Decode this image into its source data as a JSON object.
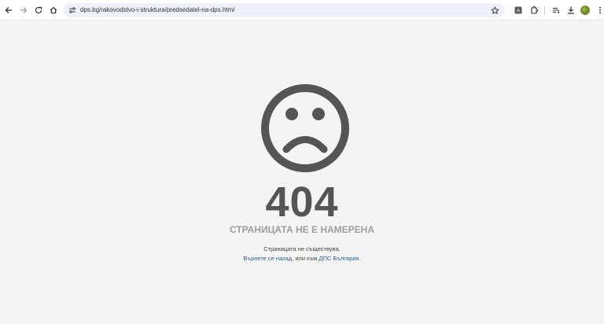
{
  "browser": {
    "url": "dps.bg/rakovodstvo-i-struktura/predsedatel-na-dps.html",
    "icons": [
      "back-arrow-icon",
      "forward-arrow-icon",
      "reload-icon",
      "home-icon",
      "site-info-icon",
      "bookmark-star-icon",
      "translate-icon",
      "extensions-icon",
      "reading-list-icon",
      "download-icon",
      "profile-avatar",
      "kebab-menu-icon"
    ]
  },
  "error_page": {
    "code": "404",
    "title": "СТРАНИЦАТА НЕ Е НАМЕРЕНА",
    "message": "Страницата не съществува.",
    "back_link": "Върнете се назад",
    "middle_text": ", или към ",
    "home_link": "ДПС България",
    "end_text": ".",
    "colors": {
      "face": "#555555",
      "code": "#555555",
      "title": "#9e9e9e",
      "link": "#2b5d8f",
      "background": "#f4f4f4"
    }
  }
}
